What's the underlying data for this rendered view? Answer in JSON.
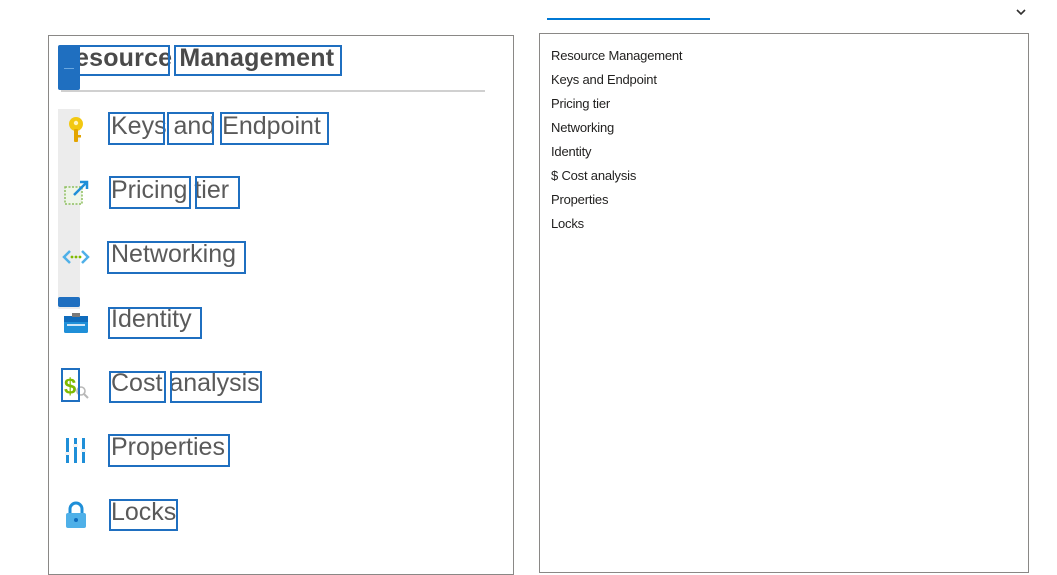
{
  "image": {
    "heading_text": "esource Management",
    "items": [
      {
        "label": "Keys and Endpoint",
        "icon": "key-icon"
      },
      {
        "label": "Pricing tier",
        "icon": "edit-pricing-icon"
      },
      {
        "label": "Networking",
        "icon": "networking-icon"
      },
      {
        "label": "Identity",
        "icon": "identity-icon"
      },
      {
        "label": "Cost analysis",
        "icon": "cost-analysis-icon"
      },
      {
        "label": "Properties",
        "icon": "properties-icon"
      },
      {
        "label": "Locks",
        "icon": "lock-icon"
      }
    ]
  },
  "extracted_text": {
    "lines": [
      "Resource Management",
      "Keys and Endpoint",
      "Pricing tier",
      "Networking",
      "Identity",
      "$ Cost analysis",
      "Properties",
      "Locks"
    ]
  },
  "colors": {
    "accent": "#0078d4",
    "word_box": "#1f6fc0"
  }
}
